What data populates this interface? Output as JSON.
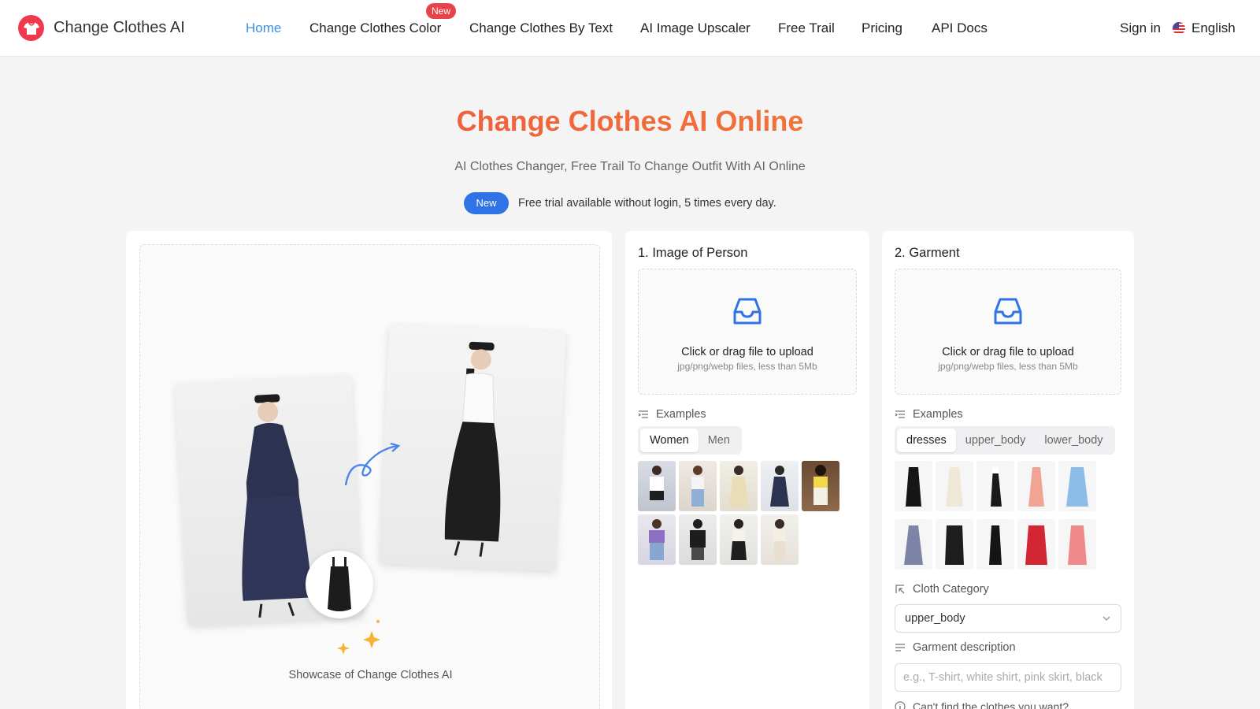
{
  "header": {
    "brand": "Change Clothes AI",
    "nav": [
      "Home",
      "Change Clothes Color",
      "Change Clothes By Text",
      "AI Image Upscaler",
      "Free Trail",
      "Pricing",
      "API Docs"
    ],
    "nav_badge": "New",
    "signin": "Sign in",
    "language": "English"
  },
  "hero": {
    "title": "Change Clothes AI Online",
    "subtitle": "AI Clothes Changer, Free Trail To Change Outfit With AI Online",
    "badge": "New",
    "notice": "Free trial available without login, 5 times every day."
  },
  "showcase": {
    "caption": "Showcase of Change Clothes AI"
  },
  "person": {
    "title": "1. Image of Person",
    "upload_text": "Click or drag file to upload",
    "upload_hint": "jpg/png/webp files, less than 5Mb",
    "examples_label": "Examples",
    "tabs": [
      "Women",
      "Men"
    ]
  },
  "garment": {
    "title": "2. Garment",
    "upload_text": "Click or drag file to upload",
    "upload_hint": "jpg/png/webp files, less than 5Mb",
    "examples_label": "Examples",
    "tabs": [
      "dresses",
      "upper_body",
      "lower_body"
    ],
    "category_label": "Cloth Category",
    "category_value": "upper_body",
    "description_label": "Garment description",
    "description_placeholder": "e.g., T-shirt, white shirt, pink skirt, black",
    "cant_find": "Can't find the clothes you want?"
  },
  "colors": {
    "accent": "#3b8ee8",
    "brand": "#ef3a4d",
    "title_gradient_start": "#ef4a3c",
    "title_gradient_end": "#f28a3a",
    "badge_blue": "#2f73e6"
  }
}
